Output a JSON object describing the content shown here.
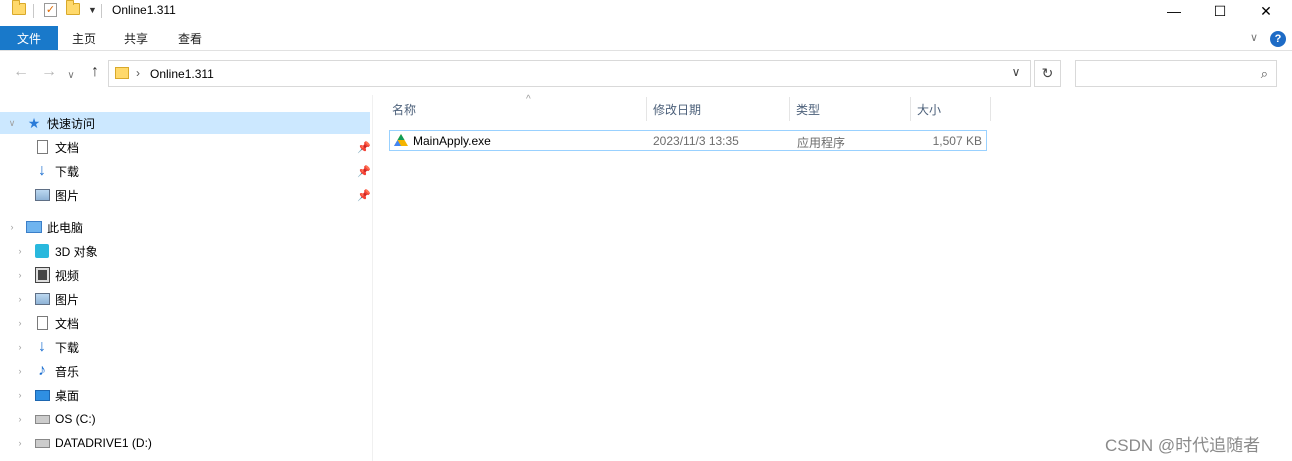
{
  "window": {
    "title": "Online1.311",
    "minimize": "—",
    "maximize": "☐",
    "close": "✕"
  },
  "ribbon": {
    "tabs": [
      "文件",
      "主页",
      "共享",
      "查看"
    ],
    "help": "?"
  },
  "address": {
    "path": "Online1.311",
    "search_placeholder": ""
  },
  "sidebar": {
    "quick_access": "快速访问",
    "quick_items": [
      "文档",
      "下载",
      "图片"
    ],
    "this_pc": "此电脑",
    "pc_items": [
      "3D 对象",
      "视频",
      "图片",
      "文档",
      "下载",
      "音乐",
      "桌面",
      "OS (C:)",
      "DATADRIVE1 (D:)"
    ]
  },
  "columns": {
    "name": "名称",
    "modified": "修改日期",
    "type": "类型",
    "size": "大小"
  },
  "files": [
    {
      "name": "MainApply.exe",
      "modified": "2023/11/3 13:35",
      "type": "应用程序",
      "size": "1,507 KB"
    }
  ],
  "watermark": "CSDN @时代追随者"
}
